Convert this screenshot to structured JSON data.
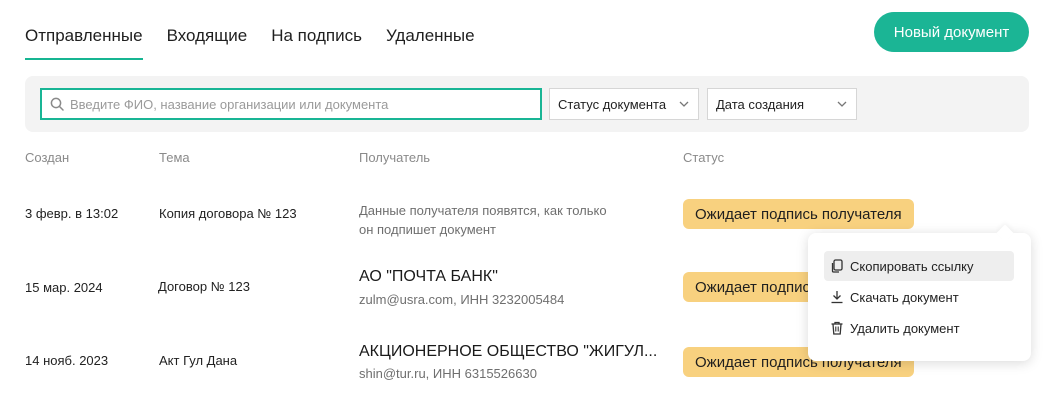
{
  "tabs": [
    {
      "label": "Отправленные"
    },
    {
      "label": "Входящие"
    },
    {
      "label": "На подпись"
    },
    {
      "label": "Удаленные"
    }
  ],
  "new_document_button": "Новый документ",
  "search": {
    "placeholder": "Введите ФИО, название организации или документа",
    "value": ""
  },
  "filters": {
    "status": "Статус документа",
    "date": "Дата создания"
  },
  "columns": {
    "created": "Создан",
    "subject": "Тема",
    "recipient": "Получатель",
    "status": "Статус"
  },
  "rows": [
    {
      "created": "3 февр. в 13:02",
      "subject": "Копия договора № 123",
      "recipient_placeholder_line1": "Данные получателя появятся, как только",
      "recipient_placeholder_line2": "он подпишет документ",
      "status": "Ожидает подпись получателя"
    },
    {
      "created": "15 мар. 2024",
      "subject": "Договор № 123",
      "recipient_name": "АО \"ПОЧТА БАНК\"",
      "recipient_details": "zulm@usra.com, ИНН 3232005484",
      "status": "Ожидает подпись получателя"
    },
    {
      "created": "14 нояб. 2023",
      "subject": "Акт Гул Дана",
      "recipient_name": "АКЦИОНЕРНОЕ ОБЩЕСТВО \"ЖИГУЛ...",
      "recipient_details": "shin@tur.ru, ИНН 6315526630",
      "status": "Ожидает подпись получателя"
    }
  ],
  "context_menu": [
    {
      "label": "Скопировать ссылку",
      "icon": "copy-icon"
    },
    {
      "label": "Скачать документ",
      "icon": "download-icon"
    },
    {
      "label": "Удалить документ",
      "icon": "trash-icon"
    }
  ],
  "colors": {
    "accent": "#1bb595",
    "status_badge": "#f8d17f"
  }
}
